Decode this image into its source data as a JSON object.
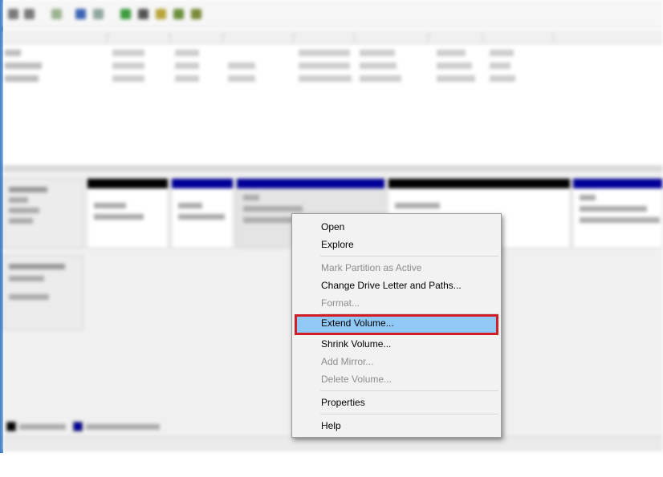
{
  "context_menu": {
    "items": [
      {
        "label": "Open",
        "enabled": true
      },
      {
        "label": "Explore",
        "enabled": true
      },
      {
        "label": "Mark Partition as Active",
        "enabled": false
      },
      {
        "label": "Change Drive Letter and Paths...",
        "enabled": true
      },
      {
        "label": "Format...",
        "enabled": false
      },
      {
        "label": "Extend Volume...",
        "enabled": true,
        "highlighted": true
      },
      {
        "label": "Shrink Volume...",
        "enabled": true
      },
      {
        "label": "Add Mirror...",
        "enabled": false
      },
      {
        "label": "Delete Volume...",
        "enabled": false
      },
      {
        "label": "Properties",
        "enabled": true
      },
      {
        "label": "Help",
        "enabled": true
      }
    ]
  },
  "colors": {
    "highlight_fill": "#90c8f6",
    "highlight_border": "#d21f26",
    "menu_background": "#f2f2f2",
    "disabled_text": "#8d8d8d",
    "unallocated_bar": "#000000",
    "primary_partition_bar": "#000099"
  }
}
